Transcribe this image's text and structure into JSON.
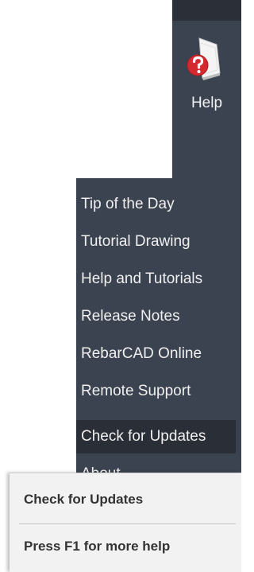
{
  "ribbon": {
    "help_label": "Help",
    "help_icon": "help-book-icon",
    "colors": {
      "panel": "#3b4350",
      "top_strip": "#2b3038",
      "icon_red": "#d42a2f"
    }
  },
  "menu": {
    "items": [
      {
        "label": "Tip of the Day"
      },
      {
        "label": "Tutorial Drawing"
      },
      {
        "label": "Help and Tutorials"
      },
      {
        "label": "Release Notes"
      },
      {
        "label": "RebarCAD Online"
      },
      {
        "label": "Remote Support"
      },
      {
        "label": "Check for Updates",
        "hovered": true
      },
      {
        "label": "About"
      }
    ],
    "colors": {
      "background": "#3b4350",
      "hover": "#2a2f37",
      "text": "#f0f0f0"
    }
  },
  "tooltip": {
    "title": "Check for Updates",
    "hint": "Press F1 for more help",
    "colors": {
      "background": "#f2f2f2",
      "text": "#333333"
    }
  }
}
